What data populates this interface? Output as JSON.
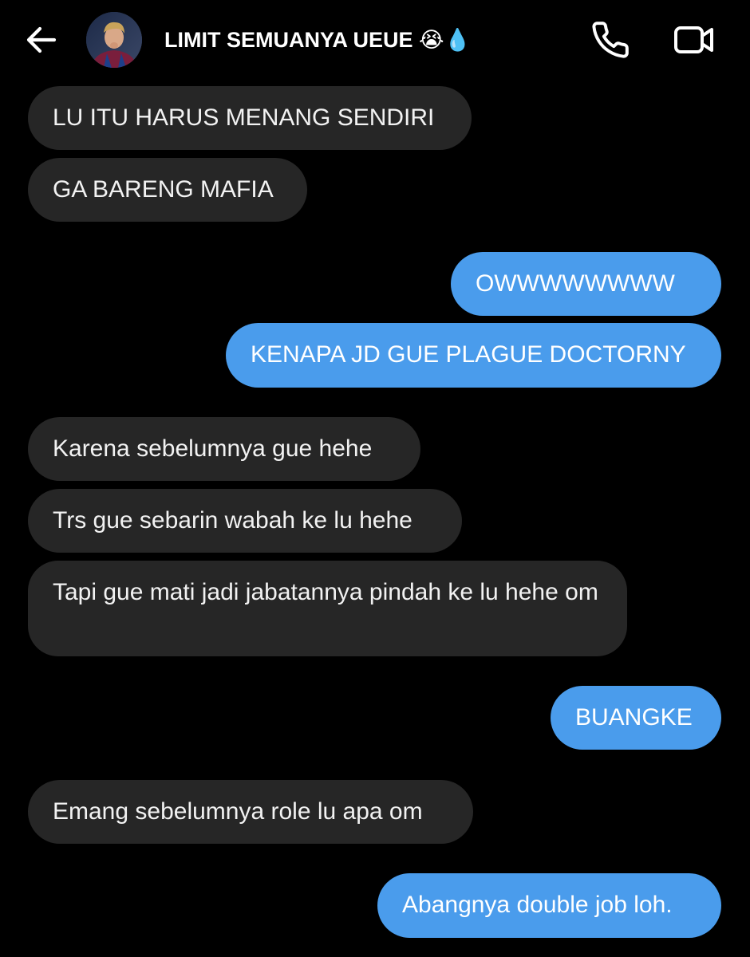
{
  "header": {
    "title": "LIMIT SEMUANYA UEUE 😭💧",
    "back_icon": "arrow-left-icon",
    "call_icon": "phone-icon",
    "video_icon": "video-camera-icon"
  },
  "colors": {
    "background": "#000000",
    "incoming_bubble": "#262626",
    "outgoing_bubble": "#4a9cec",
    "text": "#ffffff"
  },
  "messages": [
    {
      "direction": "incoming",
      "text": "LU ITU HARUS MENANG SENDIRI"
    },
    {
      "direction": "incoming",
      "text": "GA BARENG MAFIA"
    },
    {
      "direction": "outgoing",
      "text": "OWWWWWWWW"
    },
    {
      "direction": "outgoing",
      "text": "KENAPA JD GUE PLAGUE DOCTORNY"
    },
    {
      "direction": "incoming",
      "text": "Karena sebelumnya gue hehe"
    },
    {
      "direction": "incoming",
      "text": "Trs gue sebarin wabah ke lu hehe"
    },
    {
      "direction": "incoming",
      "text": "Tapi gue mati jadi jabatannya pindah ke lu hehe om"
    },
    {
      "direction": "outgoing",
      "text": "BUANGKE"
    },
    {
      "direction": "incoming",
      "text": "Emang sebelumnya role lu apa om"
    },
    {
      "direction": "outgoing",
      "text": "Abangnya double job loh."
    }
  ]
}
